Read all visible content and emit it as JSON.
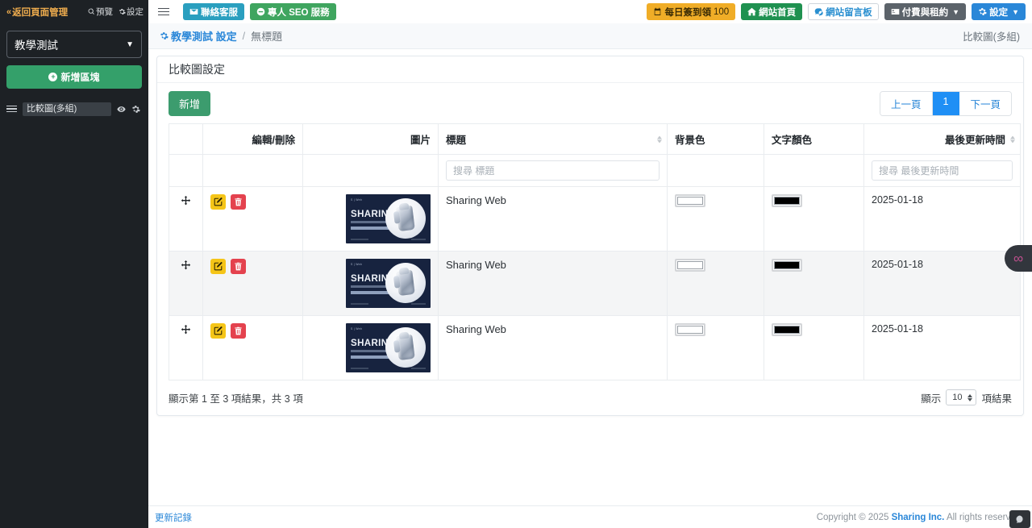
{
  "sidebar": {
    "back_label": "返回頁面管理",
    "preview_label": "預覽",
    "settings_label": "設定",
    "site_select_value": "教學測試",
    "add_block_label": "新增區塊",
    "blocks": [
      {
        "name": "比較圖(多組)"
      }
    ]
  },
  "topbar": {
    "contact_label": "聯絡客服",
    "seo_label": "專人 SEO 服務",
    "checkin_label": "每日簽到領",
    "checkin_count": "100",
    "home_label": "網站首頁",
    "guestbook_label": "網站留言板",
    "billing_label": "付費與租約",
    "settings_label": "設定"
  },
  "breadcrumb": {
    "parent": "教學測試 設定",
    "separator": "/",
    "current": "無標題",
    "right_label": "比較圖(多組)"
  },
  "card": {
    "title": "比較圖設定",
    "add_button": "新增",
    "pagination": {
      "prev": "上一頁",
      "pages": [
        "1"
      ],
      "next": "下一頁",
      "active": "1"
    },
    "table": {
      "columns": [
        {
          "label": "",
          "sortable": false
        },
        {
          "label": "編輯/刪除",
          "sortable": false
        },
        {
          "label": "圖片",
          "sortable": false
        },
        {
          "label": "標題",
          "sortable": true
        },
        {
          "label": "背景色",
          "sortable": false
        },
        {
          "label": "文字顏色",
          "sortable": false
        },
        {
          "label": "最後更新時間",
          "sortable": true
        }
      ],
      "filters": {
        "title_placeholder": "搜尋 標題",
        "updated_placeholder": "搜尋 最後更新時間"
      },
      "thumbnail": {
        "logo_text": "S | Web",
        "headline": "SHARING"
      },
      "rows": [
        {
          "title": "Sharing Web",
          "background_color": "#ffffff",
          "text_color": "#000000",
          "updated_at": "2025-01-18"
        },
        {
          "title": "Sharing Web",
          "background_color": "#ffffff",
          "text_color": "#000000",
          "updated_at": "2025-01-18"
        },
        {
          "title": "Sharing Web",
          "background_color": "#ffffff",
          "text_color": "#000000",
          "updated_at": "2025-01-18"
        }
      ]
    },
    "footer": {
      "summary": "顯示第 1 至 3 項結果，共 3 項",
      "length_prefix": "顯示",
      "length_value": "10",
      "length_suffix": "項結果"
    }
  },
  "page_footer": {
    "update_log": "更新記錄",
    "copyright_pre": "Copyright © 2025 ",
    "copyright_brand": "Sharing Inc.",
    "copyright_post": " All rights reserved"
  },
  "floating": {
    "infinity_glyph": "∞"
  },
  "colors": {
    "sidebar_bg": "#1d2125",
    "accent_orange": "#f0ad4e",
    "green": "#34a06a",
    "blue": "#2a87d8",
    "edit_yellow": "#f5c518",
    "delete_red": "#e4424e"
  }
}
